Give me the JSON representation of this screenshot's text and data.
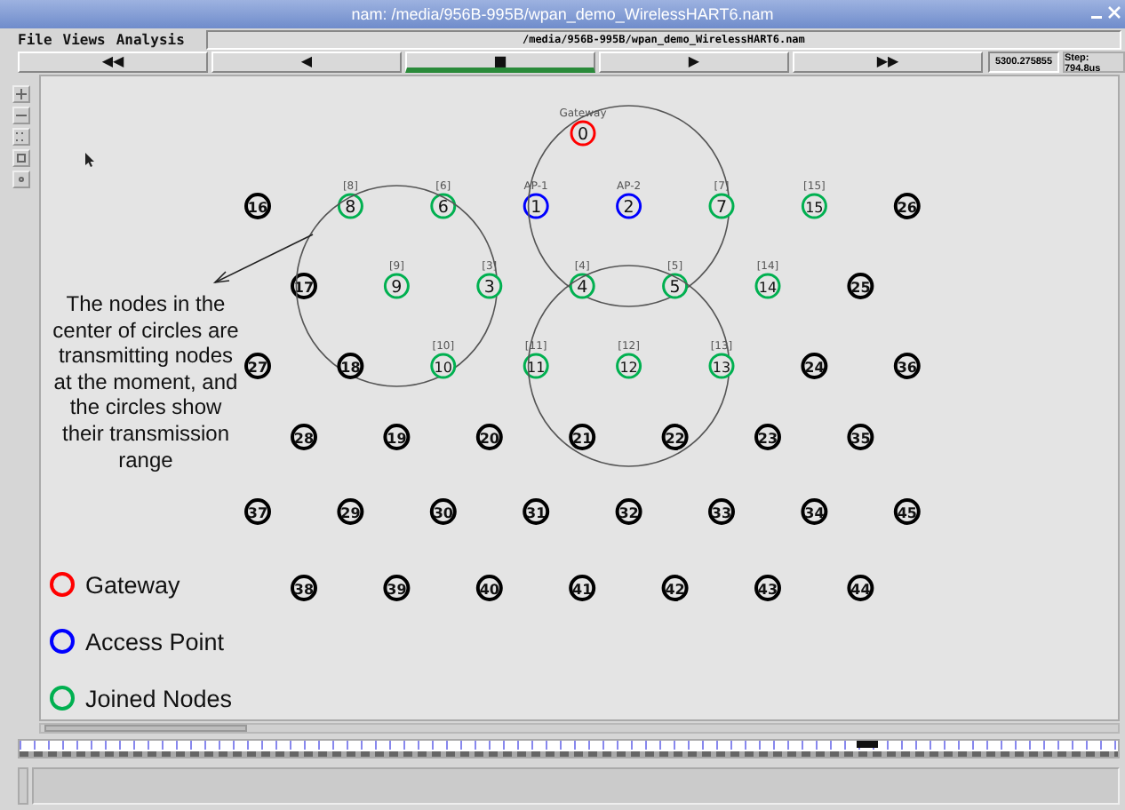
{
  "window": {
    "title": "nam: /media/956B-995B/wpan_demo_WirelessHART6.nam"
  },
  "menu": [
    "File",
    "Views",
    "Analysis"
  ],
  "file_path": "/media/956B-995B/wpan_demo_WirelessHART6.nam",
  "playback_buttons": [
    {
      "symbol": "◀◀",
      "selected": false
    },
    {
      "symbol": "◀",
      "selected": false
    },
    {
      "symbol": "■",
      "selected": true
    },
    {
      "symbol": "▶",
      "selected": false
    },
    {
      "symbol": "▶▶",
      "selected": false
    }
  ],
  "time": "5300.275855",
  "step": "Step: 794.8us",
  "annotation": "The nodes in the center of circles are transmitting nodes at the moment, and the circles show their transmission range",
  "legend": [
    {
      "kind": "gateway",
      "label": "Gateway",
      "color": "#ff0000"
    },
    {
      "kind": "access_point",
      "label": "Access Point",
      "color": "#0000ff"
    },
    {
      "kind": "joined",
      "label": "Joined Nodes",
      "color": "#00b050"
    }
  ],
  "nodes": [
    {
      "number": "0",
      "label": "Gateway",
      "kind": "gateway",
      "transmitting": false
    },
    {
      "number": "16",
      "kind": "plain",
      "transmitting": false
    },
    {
      "number": "8",
      "label": "[8]",
      "kind": "joined",
      "transmitting": false
    },
    {
      "number": "6",
      "label": "[6]",
      "kind": "joined",
      "transmitting": false
    },
    {
      "number": "1",
      "label": "AP-1",
      "kind": "access_point",
      "transmitting": false
    },
    {
      "number": "2",
      "label": "AP-2",
      "kind": "access_point",
      "transmitting": true
    },
    {
      "number": "7",
      "label": "[7]",
      "kind": "joined",
      "transmitting": false
    },
    {
      "number": "15",
      "label": "[15]",
      "kind": "joined",
      "transmitting": false
    },
    {
      "number": "26",
      "kind": "plain",
      "transmitting": false
    },
    {
      "number": "17",
      "kind": "plain",
      "transmitting": false
    },
    {
      "number": "9",
      "label": "[9]",
      "kind": "joined",
      "transmitting": true
    },
    {
      "number": "3",
      "label": "[3]",
      "kind": "joined",
      "transmitting": false
    },
    {
      "number": "4",
      "label": "[4]",
      "kind": "joined",
      "transmitting": false
    },
    {
      "number": "5",
      "label": "[5]",
      "kind": "joined",
      "transmitting": false
    },
    {
      "number": "14",
      "label": "[14]",
      "kind": "joined",
      "transmitting": false
    },
    {
      "number": "25",
      "kind": "plain",
      "transmitting": false
    },
    {
      "number": "27",
      "kind": "plain",
      "transmitting": false
    },
    {
      "number": "18",
      "kind": "plain",
      "transmitting": false
    },
    {
      "number": "10",
      "label": "[10]",
      "kind": "joined",
      "transmitting": false
    },
    {
      "number": "11",
      "label": "[11]",
      "kind": "joined",
      "transmitting": false
    },
    {
      "number": "12",
      "label": "[12]",
      "kind": "joined",
      "transmitting": true
    },
    {
      "number": "13",
      "label": "[13]",
      "kind": "joined",
      "transmitting": false
    },
    {
      "number": "24",
      "kind": "plain",
      "transmitting": false
    },
    {
      "number": "36",
      "kind": "plain",
      "transmitting": false
    },
    {
      "number": "28",
      "kind": "plain",
      "transmitting": false
    },
    {
      "number": "19",
      "kind": "plain",
      "transmitting": false
    },
    {
      "number": "20",
      "kind": "plain",
      "transmitting": false
    },
    {
      "number": "21",
      "kind": "plain",
      "transmitting": false
    },
    {
      "number": "22",
      "kind": "plain",
      "transmitting": false
    },
    {
      "number": "23",
      "kind": "plain",
      "transmitting": false
    },
    {
      "number": "35",
      "kind": "plain",
      "transmitting": false
    },
    {
      "number": "37",
      "kind": "plain",
      "transmitting": false
    },
    {
      "number": "29",
      "kind": "plain",
      "transmitting": false
    },
    {
      "number": "30",
      "kind": "plain",
      "transmitting": false
    },
    {
      "number": "31",
      "kind": "plain",
      "transmitting": false
    },
    {
      "number": "32",
      "kind": "plain",
      "transmitting": false
    },
    {
      "number": "33",
      "kind": "plain",
      "transmitting": false
    },
    {
      "number": "34",
      "kind": "plain",
      "transmitting": false
    },
    {
      "number": "45",
      "kind": "plain",
      "transmitting": false
    },
    {
      "number": "38",
      "kind": "plain",
      "transmitting": false
    },
    {
      "number": "39",
      "kind": "plain",
      "transmitting": false
    },
    {
      "number": "40",
      "kind": "plain",
      "transmitting": false
    },
    {
      "number": "41",
      "kind": "plain",
      "transmitting": false
    },
    {
      "number": "42",
      "kind": "plain",
      "transmitting": false
    },
    {
      "number": "43",
      "kind": "plain",
      "transmitting": false
    },
    {
      "number": "44",
      "kind": "plain",
      "transmitting": false
    }
  ]
}
